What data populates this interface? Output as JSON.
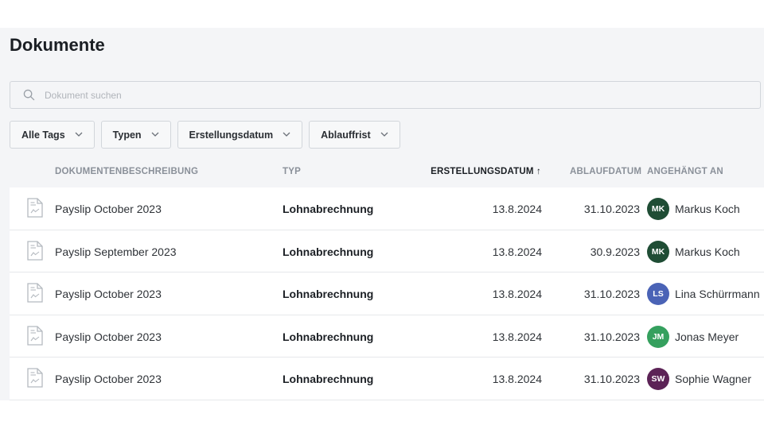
{
  "page": {
    "title": "Dokumente"
  },
  "search": {
    "placeholder": "Dokument suchen",
    "icon": "search-icon"
  },
  "filters": [
    {
      "label": "Alle Tags"
    },
    {
      "label": "Typen"
    },
    {
      "label": "Erstellungsdatum"
    },
    {
      "label": "Ablauffrist"
    }
  ],
  "table": {
    "columns": {
      "description": "DOKUMENTENBESCHREIBUNG",
      "type": "TYP",
      "created": "ERSTELLUNGSDATUM",
      "sort_indicator": "↑",
      "expiry": "ABLAUFDATUM",
      "attached": "ANGEHÄNGT AN"
    },
    "sorted_by": "created",
    "sort_direction": "ascending",
    "rows": [
      {
        "description": "Payslip October 2023",
        "type": "Lohnabrechnung",
        "created": "13.8.2024",
        "expiry": "31.10.2023",
        "initials": "MK",
        "person": "Markus Koch",
        "color": "#1f4d35"
      },
      {
        "description": "Payslip September 2023",
        "type": "Lohnabrechnung",
        "created": "13.8.2024",
        "expiry": "30.9.2023",
        "initials": "MK",
        "person": "Markus Koch",
        "color": "#1f4d35"
      },
      {
        "description": "Payslip October 2023",
        "type": "Lohnabrechnung",
        "created": "13.8.2024",
        "expiry": "31.10.2023",
        "initials": "LS",
        "person": "Lina Schürrmann",
        "color": "#4a63b6"
      },
      {
        "description": "Payslip October 2023",
        "type": "Lohnabrechnung",
        "created": "13.8.2024",
        "expiry": "31.10.2023",
        "initials": "JM",
        "person": "Jonas Meyer",
        "color": "#35a05e"
      },
      {
        "description": "Payslip October 2023",
        "type": "Lohnabrechnung",
        "created": "13.8.2024",
        "expiry": "31.10.2023",
        "initials": "SW",
        "person": "Sophie Wagner",
        "color": "#5c2356"
      }
    ]
  }
}
